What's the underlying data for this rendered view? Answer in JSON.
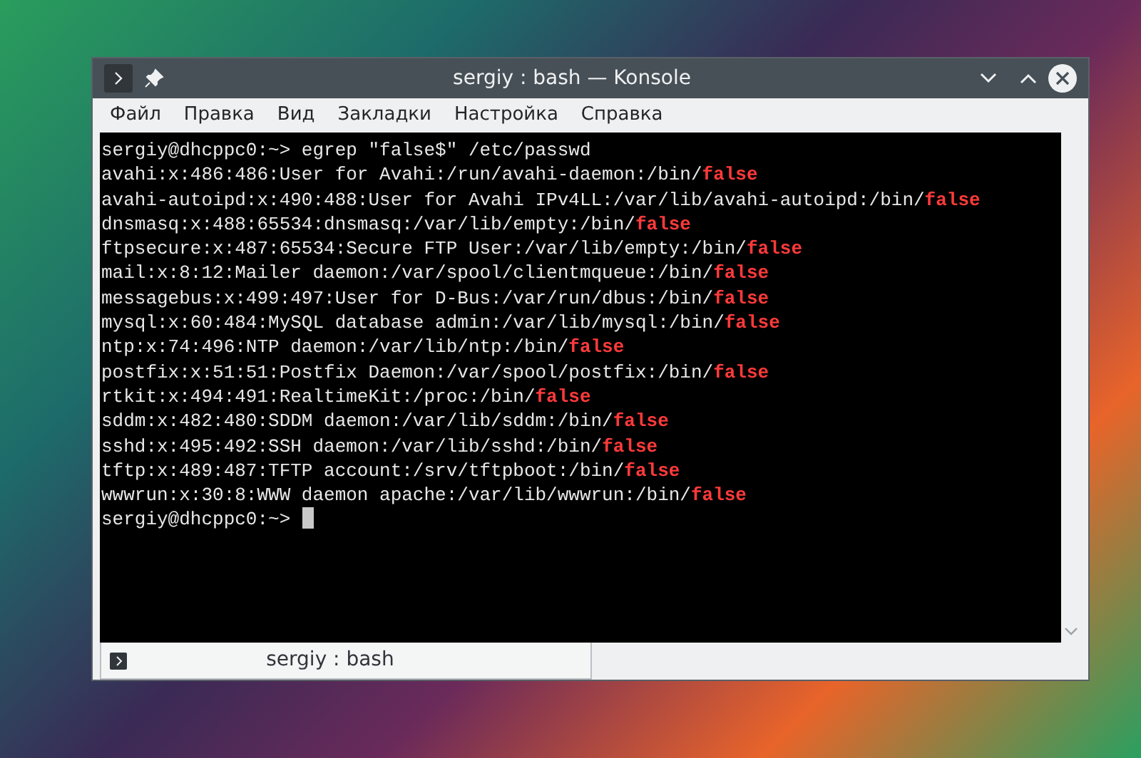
{
  "window": {
    "title": "sergiy : bash — Konsole"
  },
  "menu": [
    "Файл",
    "Правка",
    "Вид",
    "Закладки",
    "Настройка",
    "Справка"
  ],
  "terminal": {
    "lines": [
      {
        "kind": "command",
        "text": "sergiy@dhcppc0:~> egrep \"false$\" /etc/passwd"
      },
      {
        "kind": "output",
        "text": "avahi:x:486:486:User for Avahi:/run/avahi-daemon:/bin/",
        "match": "false"
      },
      {
        "kind": "output",
        "text": "avahi-autoipd:x:490:488:User for Avahi IPv4LL:/var/lib/avahi-autoipd:/bin/",
        "match": "false"
      },
      {
        "kind": "output",
        "text": "dnsmasq:x:488:65534:dnsmasq:/var/lib/empty:/bin/",
        "match": "false"
      },
      {
        "kind": "output",
        "text": "ftpsecure:x:487:65534:Secure FTP User:/var/lib/empty:/bin/",
        "match": "false"
      },
      {
        "kind": "output",
        "text": "mail:x:8:12:Mailer daemon:/var/spool/clientmqueue:/bin/",
        "match": "false"
      },
      {
        "kind": "output",
        "text": "messagebus:x:499:497:User for D-Bus:/var/run/dbus:/bin/",
        "match": "false"
      },
      {
        "kind": "output",
        "text": "mysql:x:60:484:MySQL database admin:/var/lib/mysql:/bin/",
        "match": "false"
      },
      {
        "kind": "output",
        "text": "ntp:x:74:496:NTP daemon:/var/lib/ntp:/bin/",
        "match": "false"
      },
      {
        "kind": "output",
        "text": "postfix:x:51:51:Postfix Daemon:/var/spool/postfix:/bin/",
        "match": "false"
      },
      {
        "kind": "output",
        "text": "rtkit:x:494:491:RealtimeKit:/proc:/bin/",
        "match": "false"
      },
      {
        "kind": "output",
        "text": "sddm:x:482:480:SDDM daemon:/var/lib/sddm:/bin/",
        "match": "false"
      },
      {
        "kind": "output",
        "text": "sshd:x:495:492:SSH daemon:/var/lib/sshd:/bin/",
        "match": "false"
      },
      {
        "kind": "output",
        "text": "tftp:x:489:487:TFTP account:/srv/tftpboot:/bin/",
        "match": "false"
      },
      {
        "kind": "output",
        "text": "wwwrun:x:30:8:WWW daemon apache:/var/lib/wwwrun:/bin/",
        "match": "false"
      },
      {
        "kind": "prompt",
        "text": "sergiy@dhcppc0:~>"
      }
    ]
  },
  "tabs": [
    {
      "label": "sergiy : bash",
      "selected": true
    }
  ]
}
